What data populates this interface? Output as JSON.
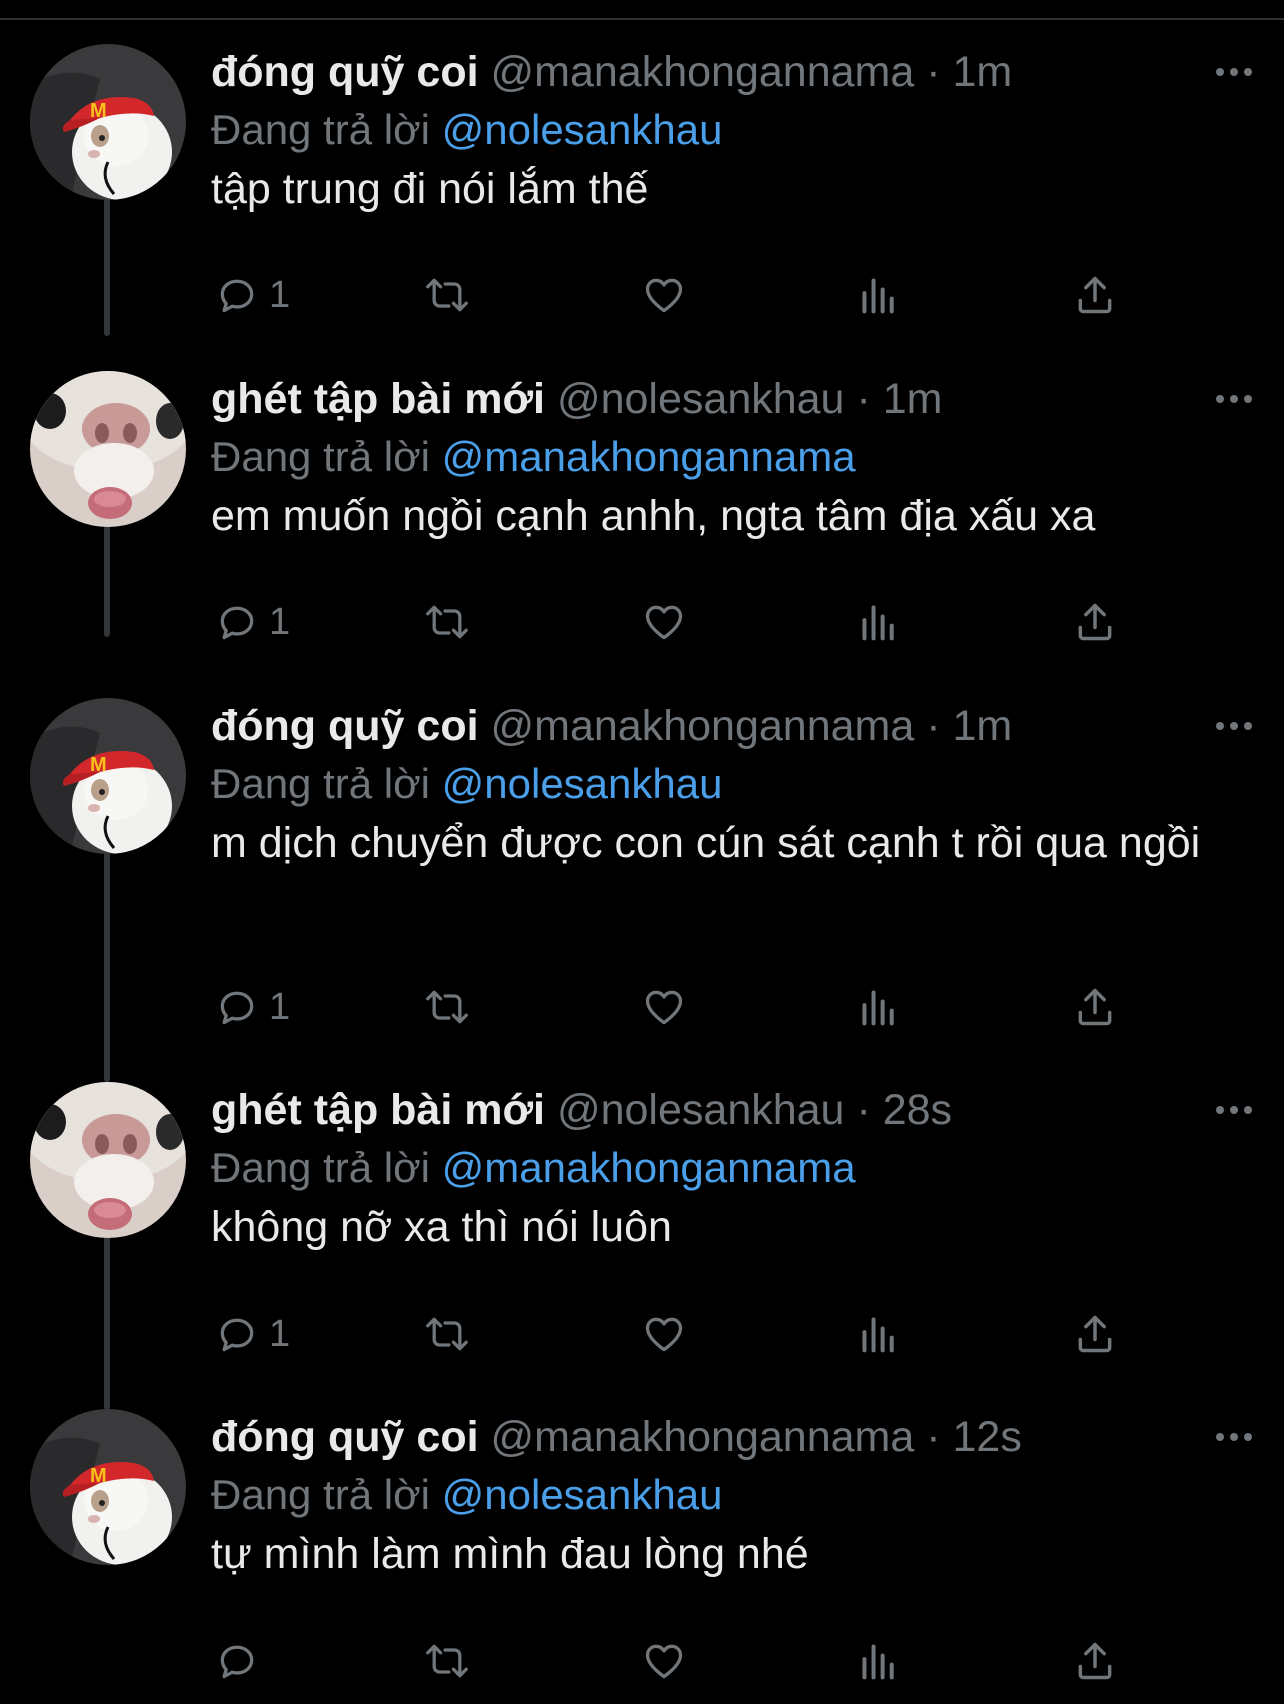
{
  "colors": {
    "background": "#000000",
    "text_primary": "#e7e9ea",
    "text_secondary": "#71767b",
    "link": "#4a9fe8",
    "thread_line": "#333639"
  },
  "ui": {
    "reply_prefix": "Đang trả lời",
    "dot": "·"
  },
  "tweets": [
    {
      "display_name": "đóng quỹ coi",
      "handle": "@manakhongannama",
      "time": "1m",
      "reply_to": "@nolesankhau",
      "text": "tập trung đi nói lắm thế",
      "reply_count": "1",
      "avatar": "rabbit-with-red-cap"
    },
    {
      "display_name": "ghét tập bài mới",
      "handle": "@nolesankhau",
      "time": "1m",
      "reply_to": "@manakhongannama",
      "text": "em muốn ngồi cạnh anhh, ngta tâm địa xấu xa",
      "reply_count": "1",
      "avatar": "rabbit-nose-closeup"
    },
    {
      "display_name": "đóng quỹ coi",
      "handle": "@manakhongannama",
      "time": "1m",
      "reply_to": "@nolesankhau",
      "text": "m dịch chuyển được con cún sát cạnh t rồi qua ngồi",
      "reply_count": "1",
      "avatar": "rabbit-with-red-cap"
    },
    {
      "display_name": "ghét tập bài mới",
      "handle": "@nolesankhau",
      "time": "28s",
      "reply_to": "@manakhongannama",
      "text": "không nỡ xa thì nói luôn",
      "reply_count": "1",
      "avatar": "rabbit-nose-closeup"
    },
    {
      "display_name": "đóng quỹ coi",
      "handle": "@manakhongannama",
      "time": "12s",
      "reply_to": "@nolesankhau",
      "text": "tự mình làm mình đau lòng nhé",
      "reply_count": "",
      "avatar": "rabbit-with-red-cap"
    }
  ]
}
